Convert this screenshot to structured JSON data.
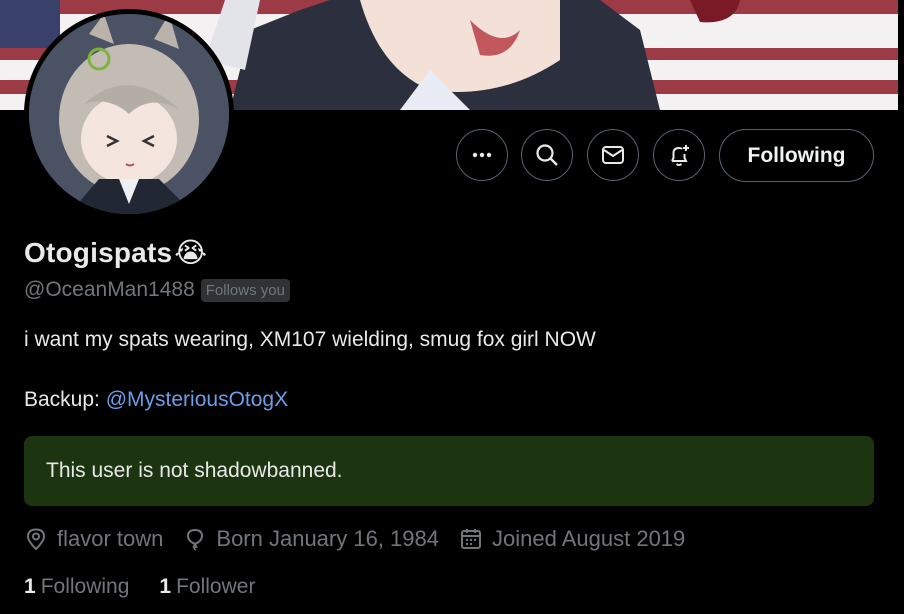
{
  "profile": {
    "display_name": "Otogispats",
    "name_emoji": "😭",
    "handle": "@OceanMan1488",
    "follows_you_badge": "Follows you",
    "bio_line1": "i want my spats wearing, XM107 wielding, smug fox girl NOW",
    "bio_backup_label": "Backup:",
    "bio_backup_link": "@MysteriousOtogX"
  },
  "actions": {
    "more_icon": "more-icon",
    "search_icon": "search-icon",
    "message_icon": "mail-icon",
    "notify_icon": "bell-plus-icon",
    "following_label": "Following"
  },
  "notice": {
    "text": "This user is not shadowbanned.",
    "color": "#1d3410"
  },
  "meta": {
    "location": "flavor town",
    "birthday": "Born January 16, 1984",
    "joined": "Joined August 2019"
  },
  "counts": {
    "following_num": "1",
    "following_label": "Following",
    "followers_num": "1",
    "followers_label": "Follower"
  },
  "colors": {
    "background": "#000000",
    "secondary_text": "#71767b",
    "link": "#6b9eea",
    "border": "#536471"
  }
}
